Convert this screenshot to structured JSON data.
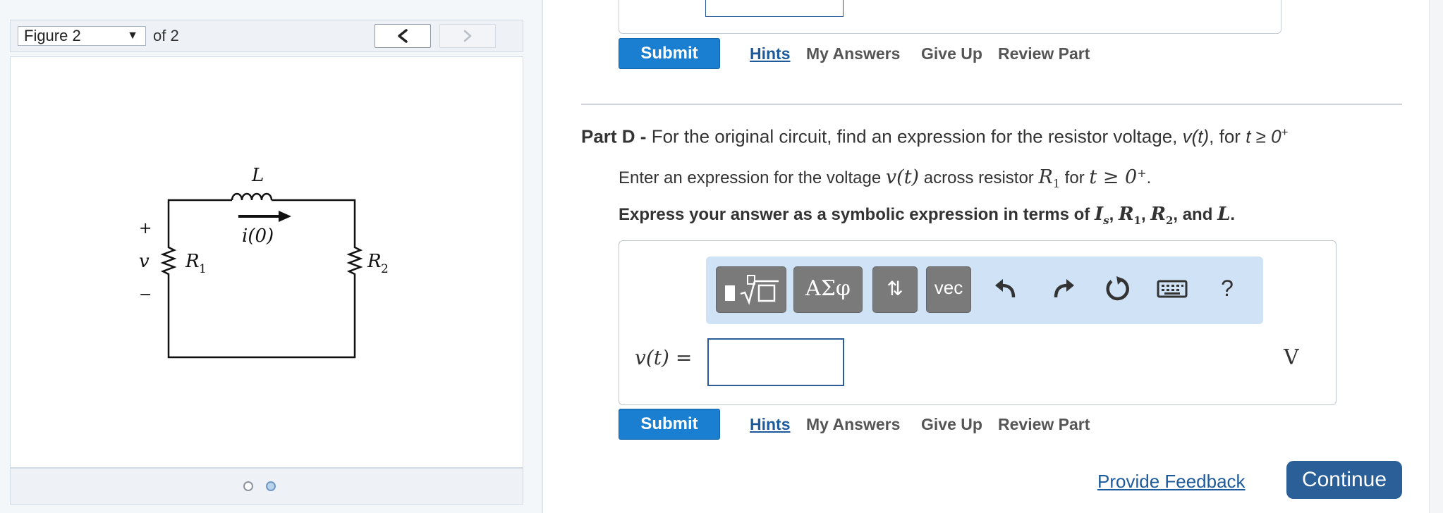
{
  "figure_panel": {
    "select_value": "Figure 2",
    "of_label": "of 2",
    "pager_dots": 2,
    "active_dot": 2
  },
  "circuit": {
    "inductor_label": "L",
    "current_label": "i(0)",
    "r1_label": "R",
    "r1_sub": "1",
    "r2_label": "R",
    "r2_sub": "2",
    "voltage_label": "v",
    "plus_label": "+",
    "minus_label": "−"
  },
  "part_c": {
    "submit_label": "Submit",
    "links": {
      "hints": "Hints",
      "my_answers": "My Answers",
      "give_up": "Give Up",
      "review_part": "Review Part"
    }
  },
  "part_d": {
    "heading_label": "Part D -",
    "heading_text": "For the original circuit, find an expression for the resistor voltage,",
    "heading_var": "v(t)",
    "heading_mid": ", for",
    "heading_cond": "t ≥ 0",
    "heading_sup": "+",
    "instruction_pre": "Enter an expression for the voltage",
    "instruction_var": "v(t)",
    "instruction_mid": "across resistor",
    "instruction_r": "R",
    "instruction_r_sub": "1",
    "instruction_for": "for",
    "instruction_cond": "t ≥ 0",
    "instruction_sup": "+",
    "instruction_end": ".",
    "express_text": "Express your answer as a symbolic expression in terms of",
    "express_terms": [
      {
        "base": "I",
        "sub": "s",
        "after": ","
      },
      {
        "base": "R",
        "sub": "1",
        "after": ","
      },
      {
        "base": "R",
        "sub": "2",
        "after": ", and"
      },
      {
        "base": "L",
        "sub": "",
        "after": "."
      }
    ],
    "toolbar": {
      "greek_label": "ΑΣφ",
      "updown_label": "⇅",
      "vec_label": "vec",
      "help_label": "?"
    },
    "answer_label": "v(t) =",
    "answer_value": "",
    "unit": "V",
    "submit_label": "Submit",
    "links": {
      "hints": "Hints",
      "my_answers": "My Answers",
      "give_up": "Give Up",
      "review_part": "Review Part"
    }
  },
  "footer": {
    "feedback_label": "Provide Feedback",
    "continue_label": "Continue"
  },
  "colors": {
    "submit": "#1a7ed1",
    "continue": "#2b5f98",
    "link": "#1c5a9c",
    "toolbar_bg": "#cfe2f6"
  }
}
